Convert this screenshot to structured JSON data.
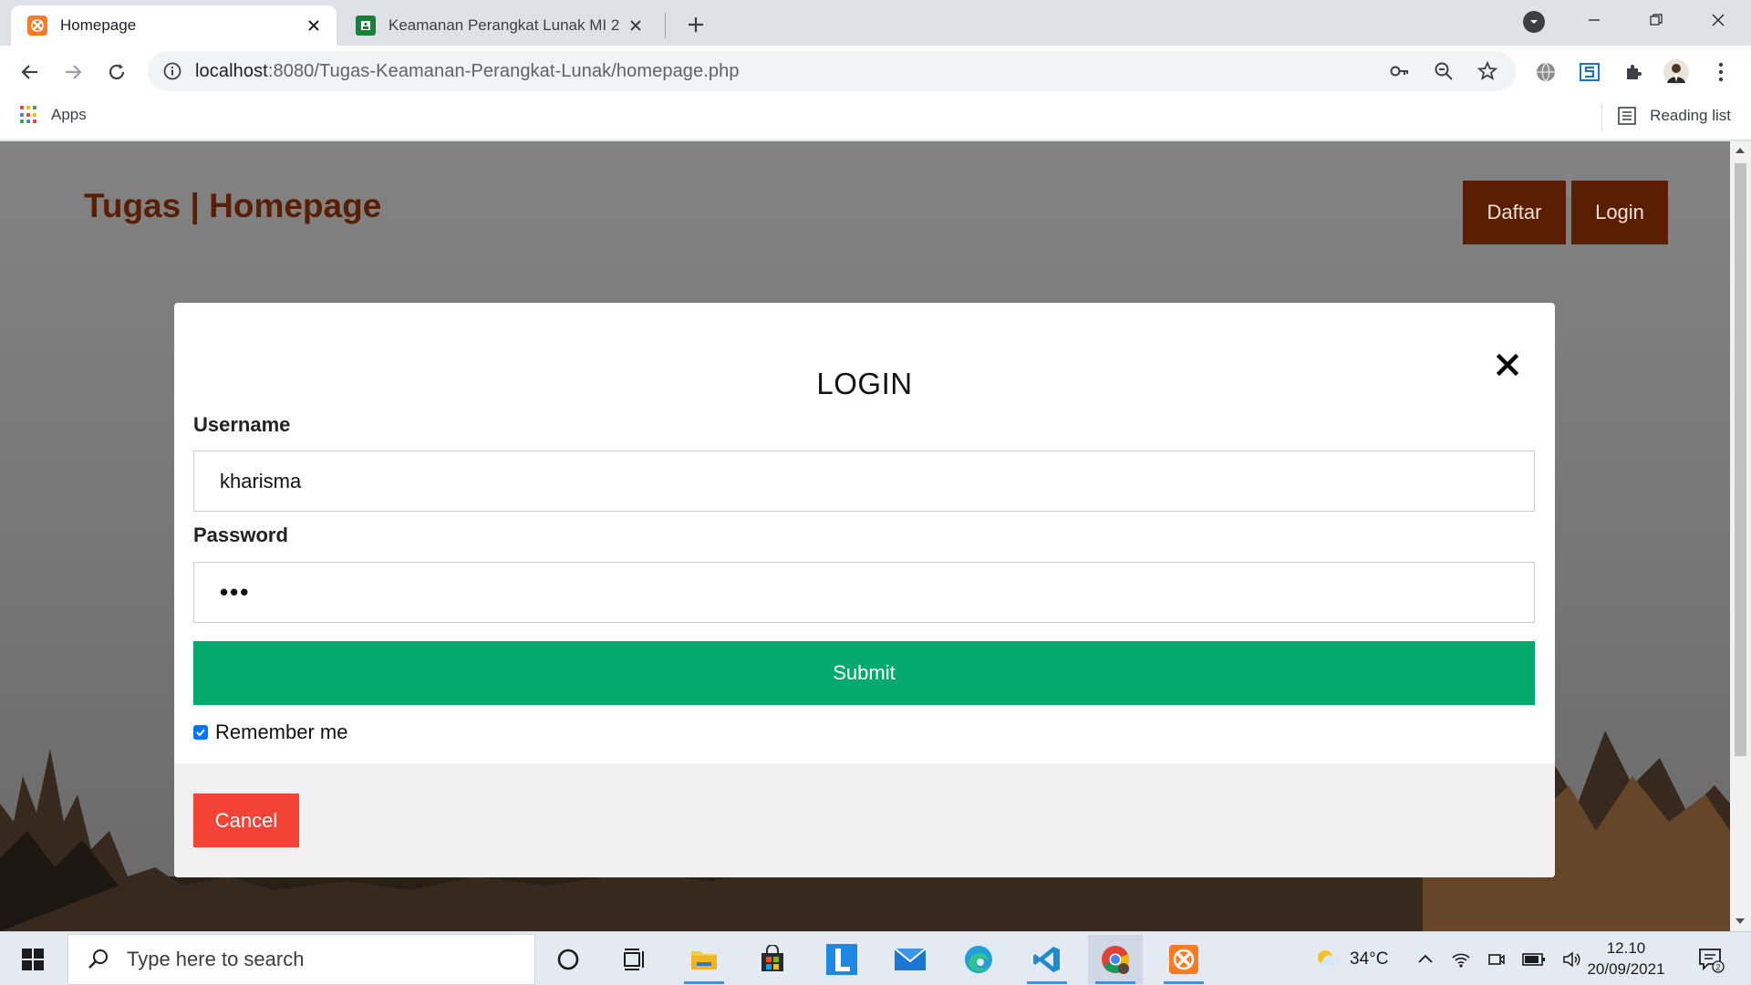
{
  "browser": {
    "tabs": [
      {
        "title": "Homepage",
        "active": true,
        "favicon": "xampp-icon"
      },
      {
        "title": "Keamanan Perangkat Lunak MI 2",
        "active": false,
        "favicon": "sheets-icon"
      }
    ],
    "address": {
      "host": "localhost",
      "rest": ":8080/Tugas-Keamanan-Perangkat-Lunak/homepage.php"
    },
    "bookmarks": {
      "apps_label": "Apps",
      "reading_list_label": "Reading list"
    }
  },
  "page": {
    "site_title": "Tugas | Homepage",
    "nav": {
      "register_label": "Daftar",
      "login_label": "Login"
    },
    "modal": {
      "heading": "LOGIN",
      "username_label": "Username",
      "username_value": "kharisma",
      "password_label": "Password",
      "password_value": "•••",
      "submit_label": "Submit",
      "remember_label": "Remember me",
      "remember_checked": true,
      "cancel_label": "Cancel"
    },
    "colors": {
      "brand": "#5a1f03",
      "submit": "#04aa6d",
      "cancel": "#f44336"
    }
  },
  "taskbar": {
    "search_placeholder": "Type here to search",
    "weather": "34°C",
    "time": "12.10",
    "date": "20/09/2021",
    "notification_count": "2"
  }
}
